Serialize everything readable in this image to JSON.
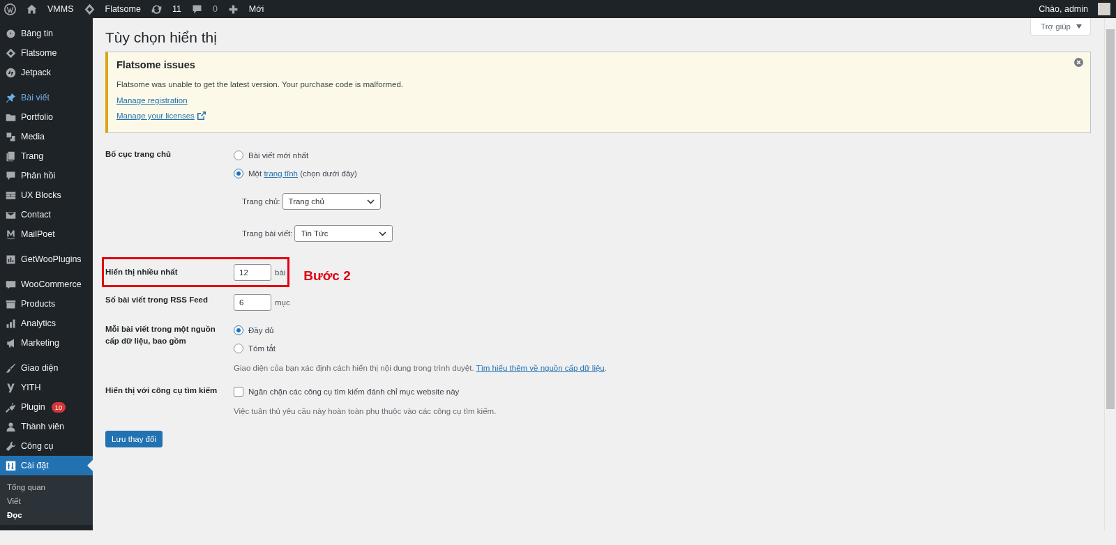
{
  "admin_bar": {
    "items": [
      {
        "kind": "logo"
      },
      {
        "kind": "home",
        "label": "VMMS"
      },
      {
        "kind": "theme",
        "label": "Flatsome"
      },
      {
        "kind": "updates",
        "label": "11"
      },
      {
        "kind": "comments",
        "label": "0"
      },
      {
        "kind": "new",
        "label": "Mới"
      }
    ],
    "greeting": "Chào, admin"
  },
  "sidebar": {
    "groups": [
      [
        {
          "label": "Bảng tin",
          "hovered": false,
          "selected": false
        },
        {
          "label": "Flatsome",
          "hovered": false,
          "selected": false
        },
        {
          "label": "Jetpack",
          "hovered": false,
          "selected": false
        }
      ],
      [
        {
          "label": "Bài viết",
          "hovered": true,
          "selected": false
        },
        {
          "label": "Portfolio",
          "hovered": false,
          "selected": false
        },
        {
          "label": "Media",
          "hovered": false,
          "selected": false
        },
        {
          "label": "Trang",
          "hovered": false,
          "selected": false
        },
        {
          "label": "Phản hồi",
          "hovered": false,
          "selected": false
        },
        {
          "label": "UX Blocks",
          "hovered": false,
          "selected": false
        },
        {
          "label": "Contact",
          "hovered": false,
          "selected": false
        },
        {
          "label": "MailPoet",
          "hovered": false,
          "selected": false
        }
      ],
      [
        {
          "label": "GetWooPlugins",
          "hovered": false,
          "selected": false
        }
      ],
      [
        {
          "label": "WooCommerce",
          "hovered": false,
          "selected": false
        },
        {
          "label": "Products",
          "hovered": false,
          "selected": false
        },
        {
          "label": "Analytics",
          "hovered": false,
          "selected": false
        },
        {
          "label": "Marketing",
          "hovered": false,
          "selected": false
        }
      ],
      [
        {
          "label": "Giao diện",
          "hovered": false,
          "selected": false
        },
        {
          "label": "YITH",
          "hovered": false,
          "selected": false
        },
        {
          "label": "Plugin",
          "badge": "10",
          "hovered": false,
          "selected": false
        },
        {
          "label": "Thành viên",
          "hovered": false,
          "selected": false
        },
        {
          "label": "Công cụ",
          "hovered": false,
          "selected": false
        },
        {
          "label": "Cài đặt",
          "hovered": false,
          "selected": true,
          "children": [
            {
              "label": "Tổng quan",
              "selected": false
            },
            {
              "label": "Viết",
              "selected": false
            },
            {
              "label": "Đọc",
              "selected": true
            }
          ]
        }
      ]
    ]
  },
  "page": {
    "title": "Tùy chọn hiển thị",
    "help_button": "Trợ giúp"
  },
  "notice": {
    "title": "Flatsome issues",
    "message": "Flatsome was unable to get the latest version. Your purchase code is malformed.",
    "links": [
      {
        "label": "Manage registration",
        "external": false
      },
      {
        "label": "Manage your licenses",
        "external": true
      }
    ]
  },
  "form": {
    "rows": [
      {
        "kind": "radio",
        "label": "Bố cục trang chủ",
        "highlighted": false,
        "options": [
          {
            "parts": [
              "Bài viết mới nhất"
            ],
            "selected": false
          },
          {
            "parts": [
              "Một ",
              "trang tĩnh",
              " (chọn dưới đây)"
            ],
            "selected": true
          }
        ],
        "selects": [
          {
            "label": "Trang chủ:",
            "value": "Trang chủ"
          },
          {
            "label": "Trang bài viết:",
            "value": "Tin Tức"
          }
        ]
      },
      {
        "kind": "number",
        "label": "Hiển thị nhiều nhất",
        "value": "12",
        "unit": "bài",
        "highlighted": true,
        "annotation": "Bước 2"
      },
      {
        "kind": "number",
        "label": "Số bài viết trong RSS Feed",
        "value": "6",
        "unit": "mục",
        "highlighted": false
      },
      {
        "kind": "radio",
        "label": "Mỗi bài viết trong một nguồn cấp dữ liệu, bao gồm",
        "highlighted": false,
        "options": [
          {
            "parts": [
              "Đầy đủ"
            ],
            "selected": true
          },
          {
            "parts": [
              "Tóm tắt"
            ],
            "selected": false
          }
        ],
        "description": {
          "text": "Giao diện của bạn xác định cách hiển thị nội dung trong trình duyệt.",
          "link": "Tìm hiểu thêm về nguồn cấp dữ liệu",
          "after": "."
        }
      },
      {
        "kind": "checkbox",
        "label": "Hiển thị với công cụ tìm kiếm",
        "highlighted": false,
        "checked": false,
        "text": "Ngăn chặn các công cụ tìm kiếm đánh chỉ mục website này",
        "description": {
          "text": "Việc tuân thủ yêu cầu này hoàn toàn phụ thuộc vào các công cụ tìm kiếm."
        }
      }
    ],
    "submit": "Lưu thay đổi"
  }
}
